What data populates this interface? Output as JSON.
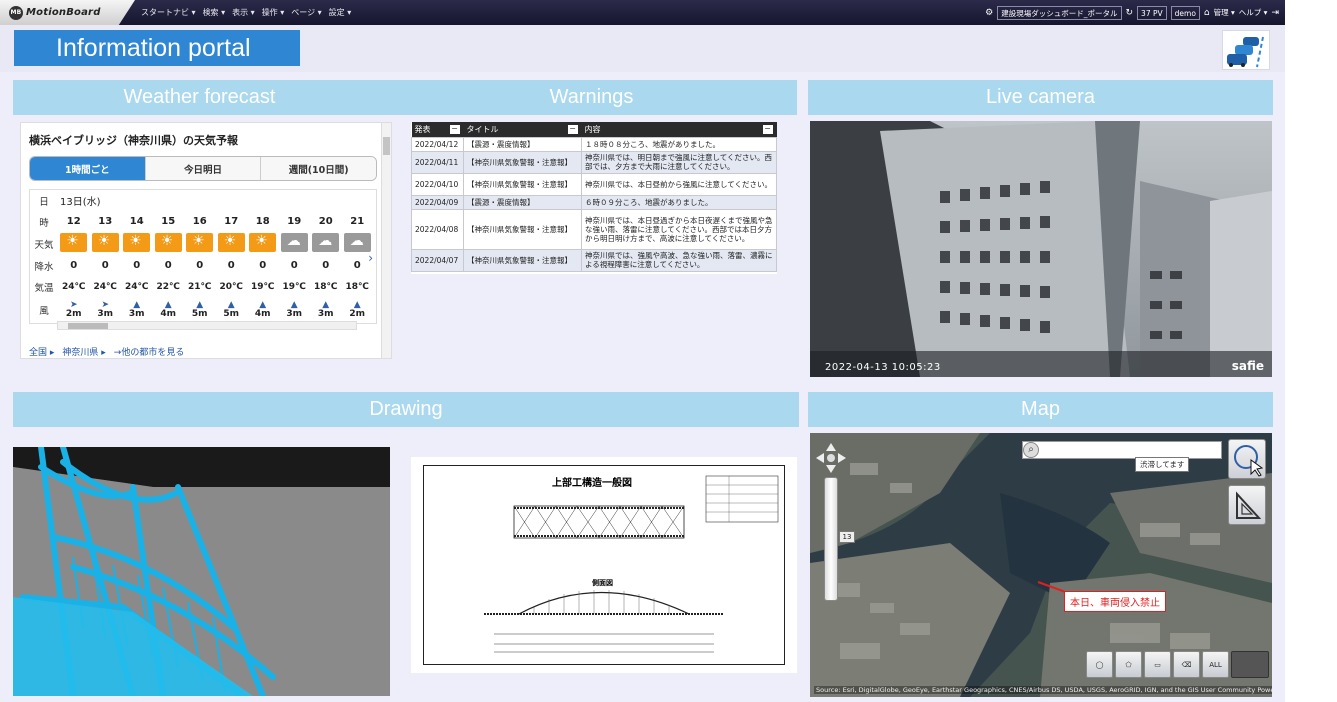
{
  "topbar": {
    "logo_badge": "MB",
    "logo_text": "MotionBoard",
    "menu": [
      "スタートナビ ▾",
      "検索 ▾",
      "表示 ▾",
      "操作 ▾",
      "ページ ▾",
      "設定 ▾"
    ],
    "board_name": "建設現場ダッシュボード_ポータル",
    "pv": "37 PV",
    "user": "demo",
    "admin": "管理 ▾",
    "help": "ヘルプ ▾"
  },
  "portal": {
    "title": "Information portal"
  },
  "sections": {
    "weather": "Weather forecast",
    "warnings": "Warnings",
    "camera": "Live camera",
    "drawing": "Drawing",
    "map": "Map"
  },
  "weather": {
    "title": "横浜ベイブリッジ（神奈川県）の天気予報",
    "tabs": [
      "1時間ごと",
      "今日明日",
      "週間(10日間)"
    ],
    "row_labels": {
      "day": "日",
      "hour": "時",
      "weather": "天気",
      "rain": "降水",
      "temp": "気温",
      "wind": "風"
    },
    "date": "13日(水)",
    "hours": [
      "12",
      "13",
      "14",
      "15",
      "16",
      "17",
      "18",
      "19",
      "20",
      "21"
    ],
    "conditions": [
      "sun",
      "sun",
      "sun",
      "sun",
      "sun",
      "sun",
      "sun",
      "cloud",
      "cloud",
      "cloud"
    ],
    "rain": [
      "0",
      "0",
      "0",
      "0",
      "0",
      "0",
      "0",
      "0",
      "0",
      "0"
    ],
    "temps": [
      "24℃",
      "24℃",
      "24℃",
      "22℃",
      "21℃",
      "20℃",
      "19℃",
      "19℃",
      "18℃",
      "18℃"
    ],
    "wind_dir": [
      "➤",
      "➤",
      "▲",
      "▲",
      "▲",
      "▲",
      "▲",
      "▲",
      "▲",
      "▲"
    ],
    "wind": [
      "2m",
      "3m",
      "3m",
      "4m",
      "5m",
      "5m",
      "4m",
      "3m",
      "3m",
      "2m"
    ],
    "links": [
      "全国 ▸",
      "神奈川県 ▸",
      "→他の都市を見る"
    ]
  },
  "warnings": {
    "columns": [
      "発表",
      "タイトル",
      "内容"
    ],
    "rows": [
      {
        "date": "2022/04/12",
        "title": "【震源・震度情報】",
        "content": "１８時０８分ころ、地震がありました。"
      },
      {
        "date": "2022/04/11",
        "title": "【神奈川県気象警報・注意報】",
        "content": "神奈川県では、明日朝まで強風に注意してください。西部では、夕方まで大雨に注意してください。"
      },
      {
        "date": "2022/04/10",
        "title": "【神奈川県気象警報・注意報】",
        "content": "神奈川県では、本日昼前から強風に注意してください。"
      },
      {
        "date": "2022/04/09",
        "title": "【震源・震度情報】",
        "content": "６時０９分ころ、地震がありました。"
      },
      {
        "date": "2022/04/08",
        "title": "【神奈川県気象警報・注意報】",
        "content": "神奈川県では、本日昼過ぎから本日夜遅くまで強風や急な強い雨、落雷に注意してください。西部では本日夕方から明日明け方まで、高波に注意してください。"
      },
      {
        "date": "2022/04/07",
        "title": "【神奈川県気象警報・注意報】",
        "content": "神奈川県では、強風や高波、急な強い雨、落雷、濃霧による視程障害に注意してください。"
      }
    ]
  },
  "camera": {
    "timestamp": "2022-04-13 10:05:23",
    "brand": "safie"
  },
  "drawing": {
    "sheet_title": "上部工構造一般図",
    "side_view": "側面図"
  },
  "map": {
    "tooltip": "渋滞してます",
    "alert": "本日、車両侵入禁止",
    "zoom_level": "13",
    "credit": "Source: Esri, DigitalGlobe, GeoEye, Earthstar Geographics, CNES/Airbus DS, USDA, USGS, AeroGRID, IGN, and the GIS User Community Powered by Esri",
    "all_label": "ALL"
  },
  "colors": {
    "accent": "#2f86d3",
    "section": "#a9d8ef",
    "sun": "#f39a17",
    "alert": "#e02020"
  }
}
